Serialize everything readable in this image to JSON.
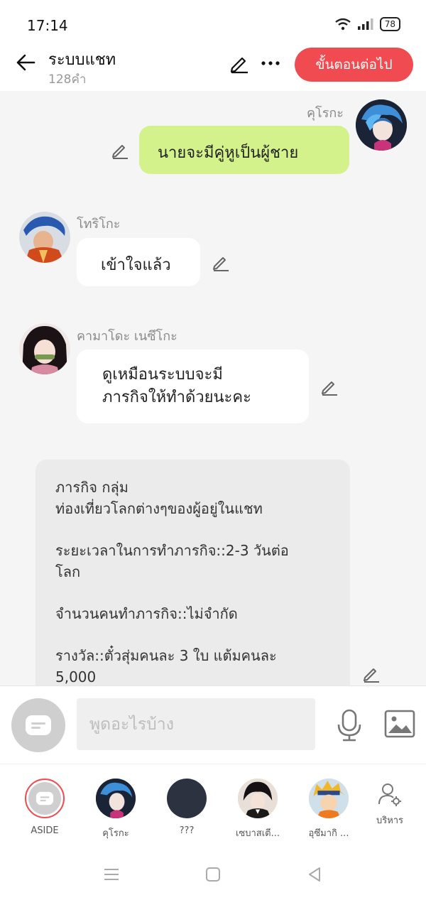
{
  "status": {
    "time": "17:14",
    "battery": "78"
  },
  "header": {
    "title": "ระบบแชท",
    "count": "128คำ",
    "next_button": "ขั้นตอนต่อไป"
  },
  "messages": [
    {
      "sender": "คุโรกะ",
      "text": "นายจะมีคู่หูเป็นผู้ชาย"
    },
    {
      "sender": "โทริโกะ",
      "text": "เข้าใจแล้ว"
    },
    {
      "sender": "คามาโดะ เนซึโกะ",
      "line1": "ดูเหมือนระบบจะมี",
      "line2": "ภารกิจให้ทำด้วยนะคะ"
    }
  ],
  "mission": {
    "line1": "ภารกิจ กลุ่ม",
    "line2": "ท่องเที่ยวโลกต่างๆของผู้อยู่ในแชท",
    "line3": "ระยะเวลาในการทำภารกิจ::2-3 วันต่อ",
    "line4": "โลก",
    "line5": "จำนวนคนทำภารกิจ::ไม่จำกัด",
    "line6": "รางวัล::ตั๋วสุ่มคนละ 3 ใบ แต้มคนละ",
    "line7": "5,000"
  },
  "input": {
    "placeholder": "พูดอะไรบ้าง"
  },
  "characters": [
    {
      "label": "ASIDE"
    },
    {
      "label": "คุโรกะ"
    },
    {
      "label": "???"
    },
    {
      "label": "เซบาสเตี..."
    },
    {
      "label": "อุซึมากิ ..."
    },
    {
      "label": "บริหาร"
    }
  ],
  "colors": {
    "accent": "#f04b50",
    "my_bubble": "#d4f28b",
    "other_bubble": "#ffffff",
    "system_bubble": "#ebebeb"
  }
}
